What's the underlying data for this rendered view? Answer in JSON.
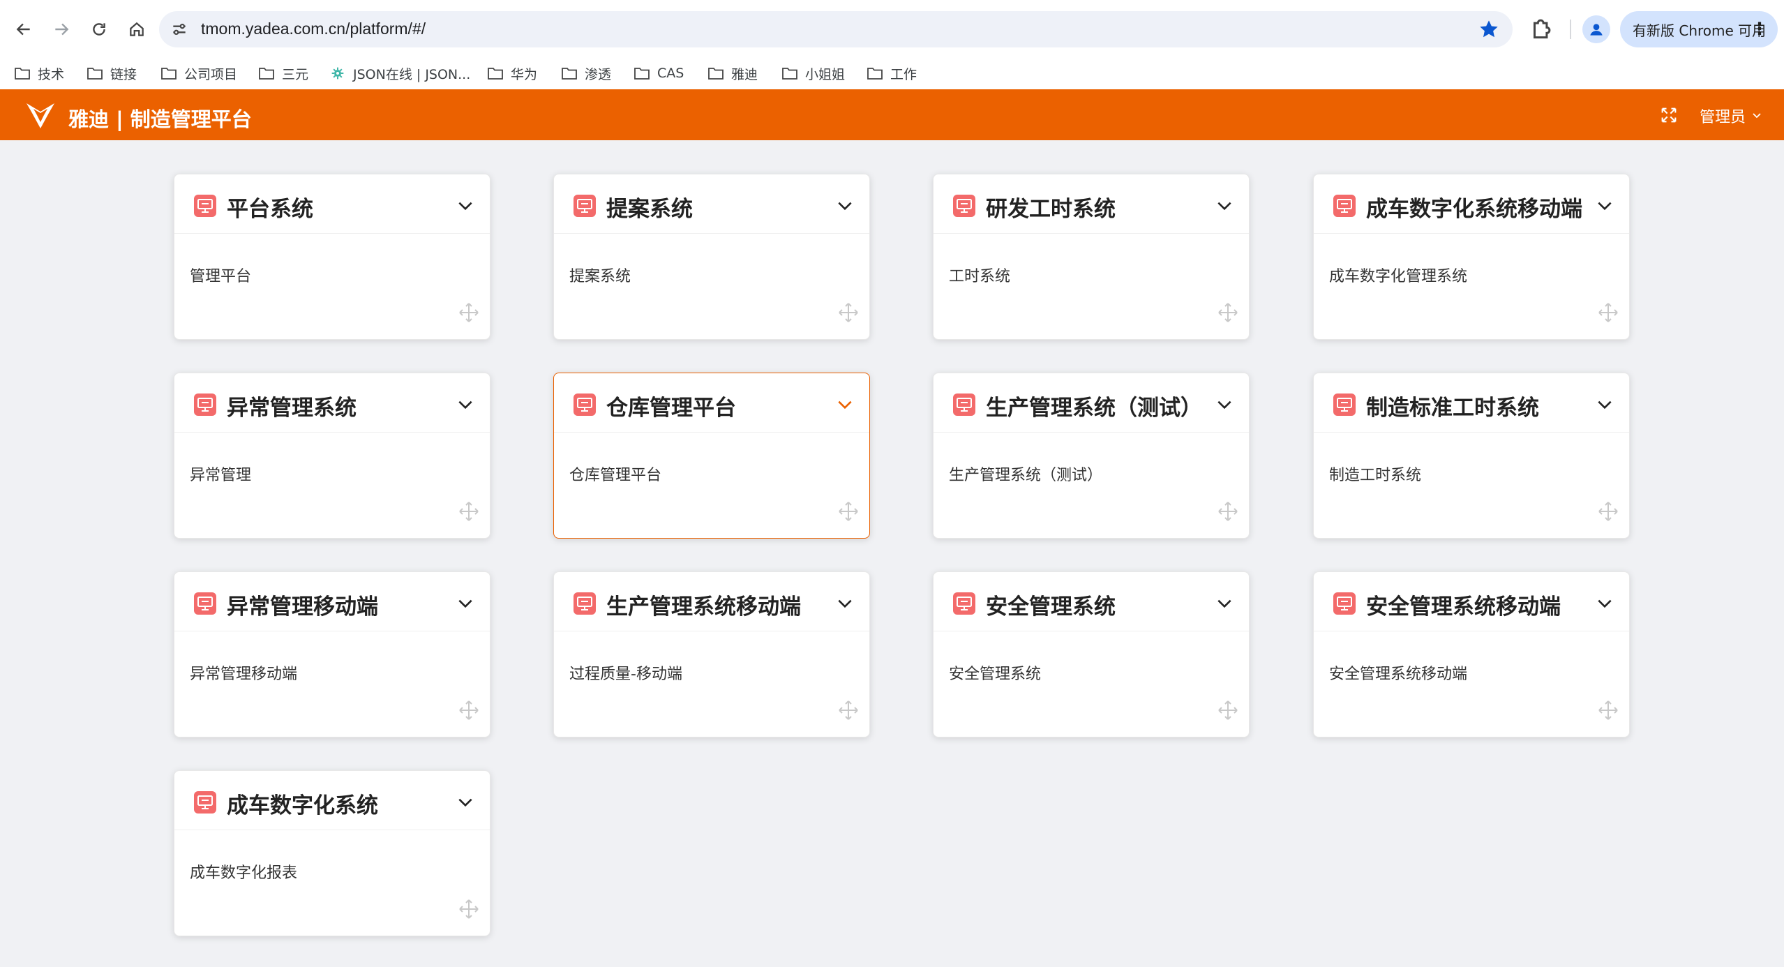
{
  "browser": {
    "url": "tmom.yadea.com.cn/platform/#/",
    "update_label": "有新版 Chrome 可用",
    "menu_dots": "⋮"
  },
  "bookmarks": [
    {
      "label": "技术",
      "icon": "folder-icon"
    },
    {
      "label": "链接",
      "icon": "folder-icon"
    },
    {
      "label": "公司项目",
      "icon": "folder-icon"
    },
    {
      "label": "三元",
      "icon": "folder-icon"
    },
    {
      "label": "JSON在线 | JSON...",
      "icon": "json-gear-icon"
    },
    {
      "label": "华为",
      "icon": "folder-icon"
    },
    {
      "label": "渗透",
      "icon": "folder-icon"
    },
    {
      "label": "CAS",
      "icon": "folder-icon"
    },
    {
      "label": "雅迪",
      "icon": "folder-icon"
    },
    {
      "label": "小姐姐",
      "icon": "folder-icon"
    },
    {
      "label": "工作",
      "icon": "folder-icon"
    }
  ],
  "header": {
    "title": "雅迪 | 制造管理平台",
    "user": "管理员",
    "brand_color": "#eb6100"
  },
  "cards": [
    {
      "title": "平台系统",
      "item": "管理平台"
    },
    {
      "title": "提案系统",
      "item": "提案系统"
    },
    {
      "title": "研发工时系统",
      "item": "工时系统"
    },
    {
      "title": "成车数字化系统移动端",
      "item": "成车数字化管理系统"
    },
    {
      "title": "异常管理系统",
      "item": "异常管理"
    },
    {
      "title": "仓库管理平台",
      "item": "仓库管理平台",
      "active": true
    },
    {
      "title": "生产管理系统（测试）",
      "item": "生产管理系统（测试）"
    },
    {
      "title": "制造标准工时系统",
      "item": "制造工时系统"
    },
    {
      "title": "异常管理移动端",
      "item": "异常管理移动端"
    },
    {
      "title": "生产管理系统移动端",
      "item": "过程质量-移动端"
    },
    {
      "title": "安全管理系统",
      "item": "安全管理系统"
    },
    {
      "title": "安全管理系统移动端",
      "item": "安全管理系统移动端"
    },
    {
      "title": "成车数字化系统",
      "item": "成车数字化报表"
    }
  ]
}
